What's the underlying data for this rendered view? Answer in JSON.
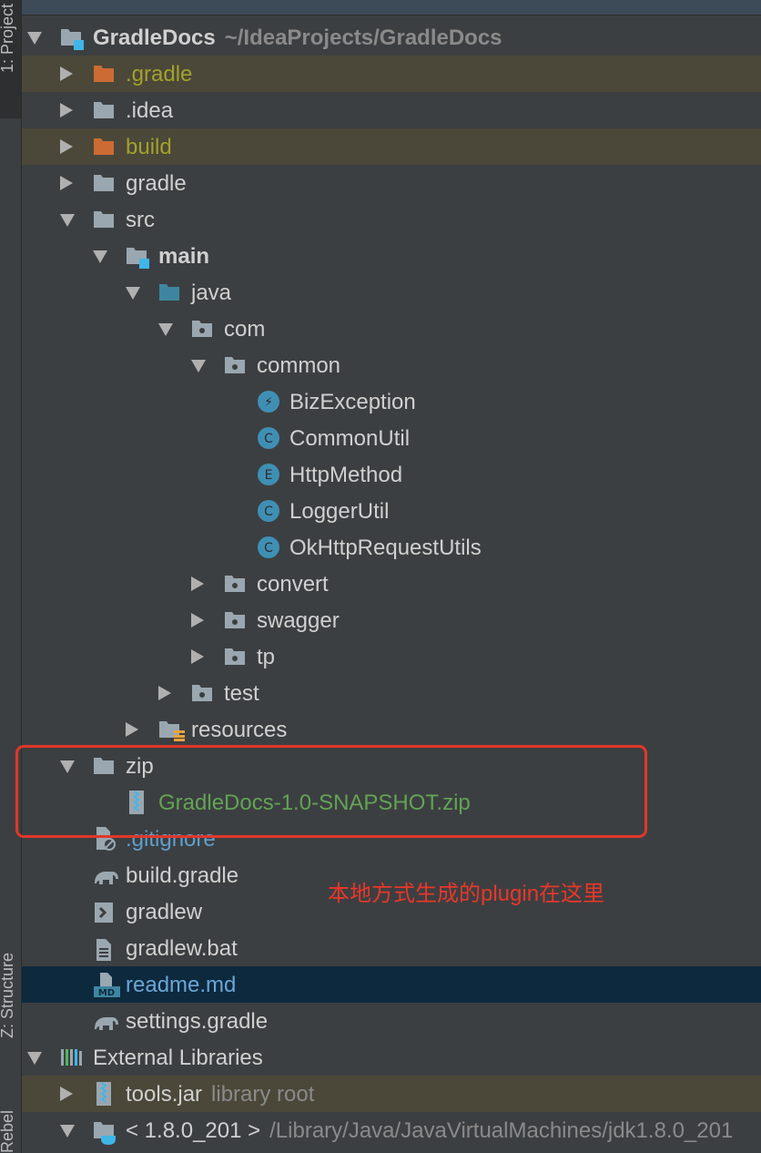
{
  "sidebar": {
    "project_tab": "1: Project",
    "structure_tab": "Z: Structure",
    "rebel_tab": "Rebel"
  },
  "colors": {
    "folder": "#9aa7b0",
    "excluded_folder": "#cc6b33",
    "excluded_text": "#a2a12c",
    "source_folder": "#3e86a0",
    "class_icon": "#3f8fb5",
    "zip_text": "#62a354",
    "gitignore_text": "#5f9fcf",
    "readme_text": "#6aa6d6",
    "annotation": "#e8372a"
  },
  "tree": [
    {
      "label": "GradleDocs",
      "sub": "~/IdeaProjects/GradleDocs",
      "level": 0,
      "arrow": "open",
      "icon": "module-folder-icon",
      "bold": true
    },
    {
      "label": ".gradle",
      "level": 1,
      "arrow": "closed",
      "icon": "excluded-folder-icon",
      "style": "excluded"
    },
    {
      "label": ".idea",
      "level": 1,
      "arrow": "closed",
      "icon": "folder-icon"
    },
    {
      "label": "build",
      "level": 1,
      "arrow": "closed",
      "icon": "excluded-folder-icon",
      "style": "excluded"
    },
    {
      "label": "gradle",
      "level": 1,
      "arrow": "closed",
      "icon": "folder-icon"
    },
    {
      "label": "src",
      "level": 1,
      "arrow": "open",
      "icon": "folder-icon"
    },
    {
      "label": "main",
      "level": 2,
      "arrow": "open",
      "icon": "module-folder-icon",
      "bold": true
    },
    {
      "label": "java",
      "level": 3,
      "arrow": "open",
      "icon": "source-folder-icon"
    },
    {
      "label": "com",
      "level": 4,
      "arrow": "open",
      "icon": "package-icon"
    },
    {
      "label": "common",
      "level": 5,
      "arrow": "open",
      "icon": "package-icon"
    },
    {
      "label": "BizException",
      "level": 6,
      "arrow": "none",
      "icon": "exception-class-icon"
    },
    {
      "label": "CommonUtil",
      "level": 6,
      "arrow": "none",
      "icon": "class-icon"
    },
    {
      "label": "HttpMethod",
      "level": 6,
      "arrow": "none",
      "icon": "enum-icon"
    },
    {
      "label": "LoggerUtil",
      "level": 6,
      "arrow": "none",
      "icon": "class-icon"
    },
    {
      "label": "OkHttpRequestUtils",
      "level": 6,
      "arrow": "none",
      "icon": "class-icon"
    },
    {
      "label": "convert",
      "level": 5,
      "arrow": "closed",
      "icon": "package-icon"
    },
    {
      "label": "swagger",
      "level": 5,
      "arrow": "closed",
      "icon": "package-icon"
    },
    {
      "label": "tp",
      "level": 5,
      "arrow": "closed",
      "icon": "package-icon"
    },
    {
      "label": "test",
      "level": 4,
      "arrow": "closed",
      "icon": "package-icon"
    },
    {
      "label": "resources",
      "level": 3,
      "arrow": "closed",
      "icon": "resources-folder-icon"
    },
    {
      "label": "zip",
      "level": 1,
      "arrow": "open",
      "icon": "folder-icon"
    },
    {
      "label": "GradleDocs-1.0-SNAPSHOT.zip",
      "level": 2,
      "arrow": "none",
      "icon": "zip-icon",
      "style": "zip"
    },
    {
      "label": ".gitignore",
      "level": 1,
      "arrow": "none",
      "icon": "gitignore-icon",
      "style": "gitignore"
    },
    {
      "label": "build.gradle",
      "level": 1,
      "arrow": "none",
      "icon": "gradle-elephant-icon"
    },
    {
      "label": "gradlew",
      "level": 1,
      "arrow": "none",
      "icon": "shell-script-icon"
    },
    {
      "label": "gradlew.bat",
      "level": 1,
      "arrow": "none",
      "icon": "text-file-icon"
    },
    {
      "label": "readme.md",
      "level": 1,
      "arrow": "none",
      "icon": "markdown-icon",
      "style": "readme",
      "selected": true
    },
    {
      "label": "settings.gradle",
      "level": 1,
      "arrow": "none",
      "icon": "gradle-elephant-icon"
    },
    {
      "label": "External Libraries",
      "level": 0,
      "arrow": "open",
      "icon": "libraries-icon"
    },
    {
      "label": "tools.jar",
      "sub": "library root",
      "level": 1,
      "arrow": "closed",
      "icon": "jar-icon",
      "highlight": true
    },
    {
      "label": "< 1.8.0_201 >",
      "sub": "/Library/Java/JavaVirtualMachines/jdk1.8.0_201",
      "level": 1,
      "arrow": "open",
      "icon": "jdk-folder-icon"
    }
  ],
  "annotation": "本地方式生成的plugin在这里"
}
